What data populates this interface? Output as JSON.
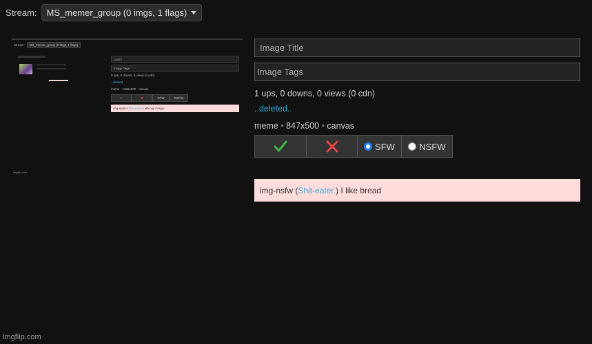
{
  "stream": {
    "label": "Stream:",
    "selected": "MS_memer_group (0 imgs, 1 flags)"
  },
  "thumbnail": {
    "stream_label": "Stream:",
    "stream_selected": "MS_memer_group (0 imgs, 1 flags)",
    "title_value": "Loss?",
    "tags_placeholder": "Image Tags",
    "stats": "0 ups, 0 downs, 0 views (0 cdn)",
    "deleted": "..deleted..",
    "meta": "meme · 1296x500 · canvas",
    "sfw": "SFW",
    "nsfw": "NSFW",
    "flag_prefix": "img-spam (",
    "flag_user": "Shit-eater.",
    "flag_suffix": ") Ma big I forgor",
    "footer": "imgflip.com"
  },
  "form": {
    "title_placeholder": "Image Title",
    "tags_placeholder": "Image Tags",
    "stats": "1 ups, 0 downs, 0 views (0 cdn)",
    "deleted_link": "..deleted..",
    "meta": {
      "type": "meme",
      "dimensions": "847x500",
      "source": "canvas"
    },
    "actions": {
      "approve_icon": "checkmark-icon",
      "reject_icon": "x-icon",
      "sfw_label": "SFW",
      "nsfw_label": "NSFW",
      "selected_rating": "SFW"
    },
    "flag": {
      "type": "img-nsfw",
      "user": "Shit-eater.",
      "message": "I like bread"
    }
  },
  "colors": {
    "approve": "#3cb84a",
    "reject": "#e84545",
    "link": "#3da6d6",
    "radio_selected": "#1b7ef2",
    "flag_bg": "#ffdcdc"
  },
  "footer": "imgflip.com"
}
